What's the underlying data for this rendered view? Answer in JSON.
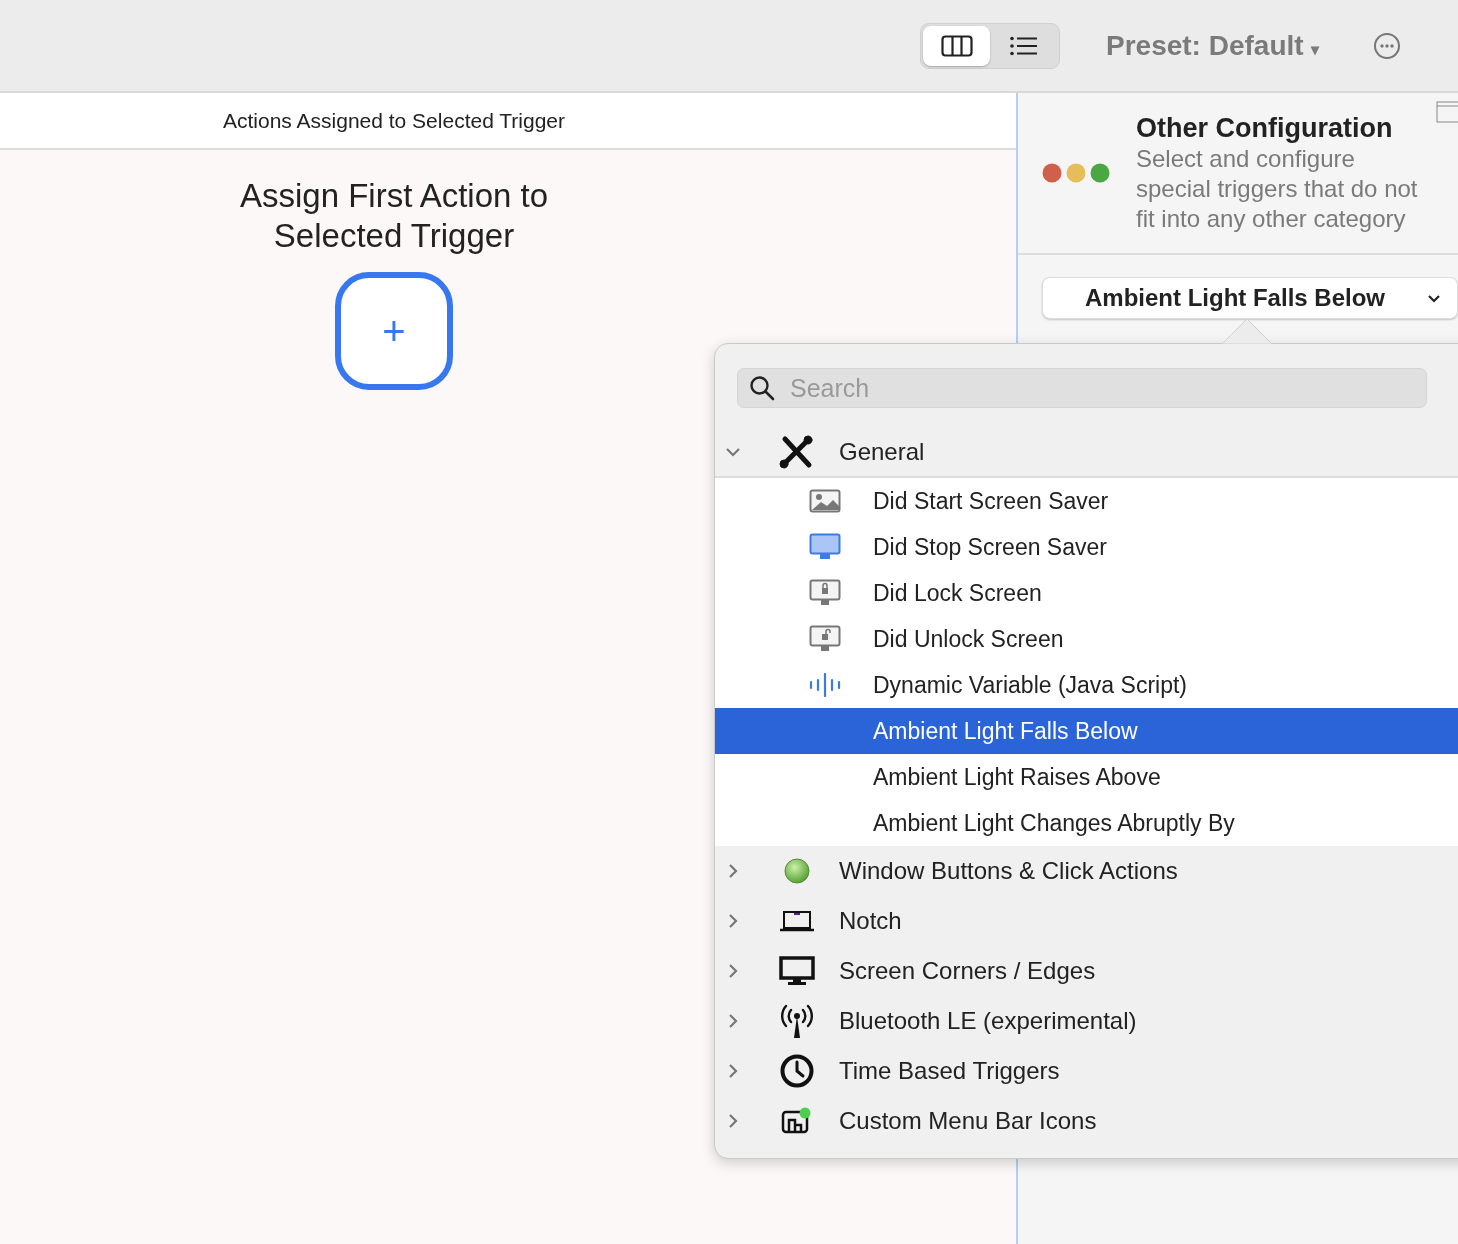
{
  "toolbar": {
    "view_segments": [
      {
        "kind": "columns",
        "selected": true
      },
      {
        "kind": "list",
        "selected": false
      }
    ],
    "preset": {
      "label": "Preset: Default",
      "caret": "▾"
    }
  },
  "actions_pane": {
    "header": "Actions Assigned to Selected Trigger",
    "empty_title": "Assign First Action to Selected Trigger",
    "add_button": "+"
  },
  "config_panel": {
    "title": "Other Configuration",
    "description": "Select and configure special triggers that do not fit into any other category",
    "trigger_select": "Ambient Light Falls Below"
  },
  "trigger_popover": {
    "search": {
      "placeholder": "Search"
    },
    "groups": [
      {
        "label": "General",
        "kind": "tools",
        "expanded": true,
        "children": [
          {
            "label": "Did Start Screen Saver",
            "kind": "image",
            "selected": false
          },
          {
            "label": "Did Stop Screen Saver",
            "kind": "screen",
            "selected": false
          },
          {
            "label": "Did Lock Screen",
            "kind": "lock",
            "selected": false
          },
          {
            "label": "Did Unlock Screen",
            "kind": "unlock",
            "selected": false
          },
          {
            "label": "Dynamic Variable (Java Script)",
            "kind": "wave",
            "selected": false
          },
          {
            "label": "Ambient Light Falls Below",
            "kind": "plain",
            "selected": true
          },
          {
            "label": "Ambient Light Raises Above",
            "kind": "plain",
            "selected": false
          },
          {
            "label": "Ambient Light Changes Abruptly By",
            "kind": "plain",
            "selected": false
          }
        ]
      },
      {
        "label": "Window Buttons & Click Actions",
        "kind": "ball",
        "expanded": false
      },
      {
        "label": "Notch",
        "kind": "laptop",
        "expanded": false
      },
      {
        "label": "Screen Corners / Edges",
        "kind": "display",
        "expanded": false
      },
      {
        "label": "Bluetooth LE (experimental)",
        "kind": "antenna",
        "expanded": false
      },
      {
        "label": "Time Based Triggers",
        "kind": "clock",
        "expanded": false
      },
      {
        "label": "Custom Menu Bar Icons",
        "kind": "menubar",
        "expanded": false
      }
    ]
  }
}
